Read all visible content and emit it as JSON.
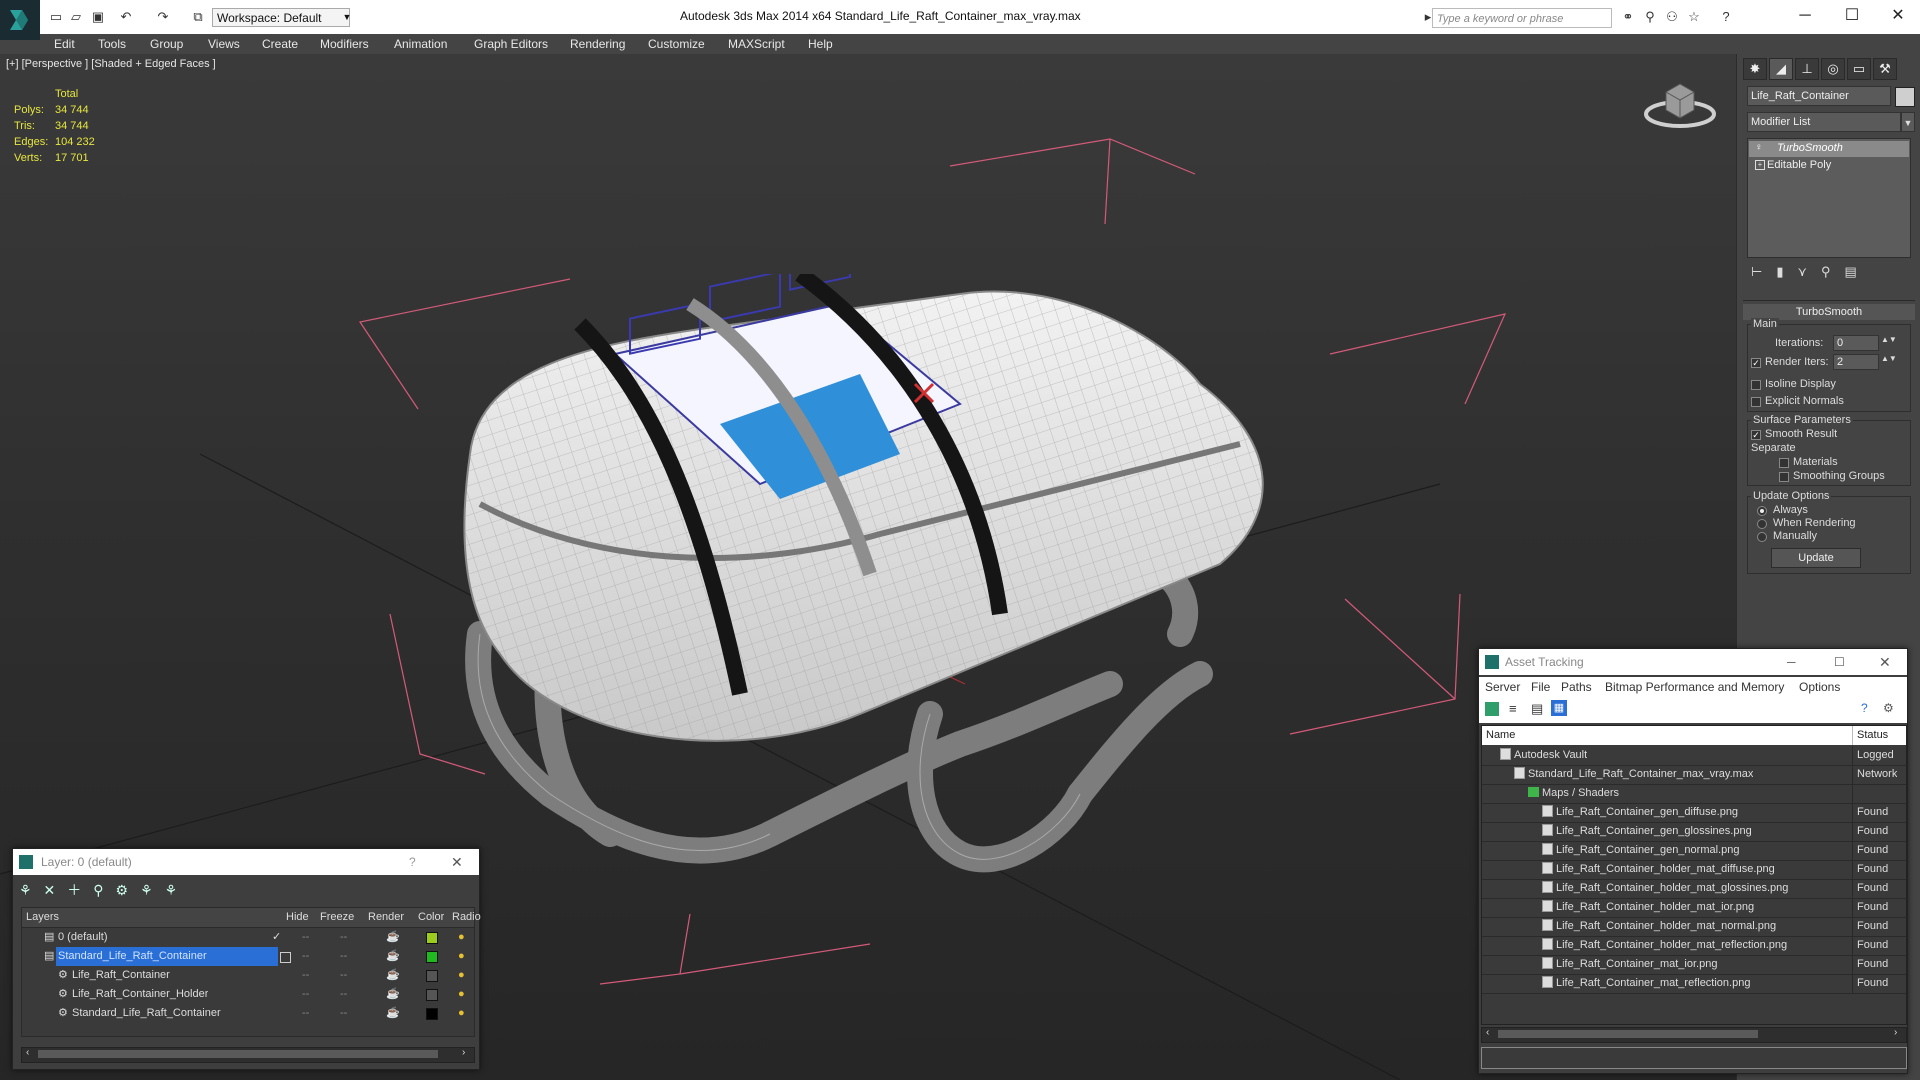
{
  "app": {
    "window_title": "Autodesk 3ds Max  2014 x64      Standard_Life_Raft_Container_max_vray.max",
    "workspace": "Workspace: Default",
    "search_placeholder": "Type a keyword or phrase"
  },
  "menu": [
    "Edit",
    "Tools",
    "Group",
    "Views",
    "Create",
    "Modifiers",
    "Animation",
    "Graph Editors",
    "Rendering",
    "Customize",
    "MAXScript",
    "Help"
  ],
  "viewport": {
    "label": "[+] [Perspective ] [Shaded + Edged Faces ]",
    "stats": {
      "header": "Total",
      "rows": [
        {
          "label": "Polys:",
          "value": "34 744"
        },
        {
          "label": "Tris:",
          "value": "34 744"
        },
        {
          "label": "Edges:",
          "value": "104 232"
        },
        {
          "label": "Verts:",
          "value": "17 701"
        }
      ]
    }
  },
  "command_panel": {
    "object_name": "Life_Raft_Container",
    "modifier_list": "Modifier List",
    "stack": [
      "TurboSmooth",
      "Editable Poly"
    ],
    "rollout_title": "TurboSmooth",
    "main_group": "Main",
    "iterations_label": "Iterations:",
    "iterations_value": "0",
    "render_iters_label": "Render Iters:",
    "render_iters_value": "2",
    "isoline": "Isoline Display",
    "explicit_normals": "Explicit Normals",
    "surface_group": "Surface Parameters",
    "smooth_result": "Smooth Result",
    "separate": "Separate",
    "materials": "Materials",
    "smoothing_groups": "Smoothing Groups",
    "update_group": "Update Options",
    "always": "Always",
    "when_rendering": "When Rendering",
    "manually": "Manually",
    "update_button": "Update"
  },
  "layer_panel": {
    "title": "Layer: 0 (default)",
    "help": "?",
    "columns": [
      "Layers",
      "Hide",
      "Freeze",
      "Render",
      "Color",
      "Radio"
    ],
    "rows": [
      {
        "name": "0 (default)",
        "color": "#9bcc1e",
        "selected": false,
        "indent": 1
      },
      {
        "name": "Standard_Life_Raft_Container",
        "color": "#22b822",
        "selected": true,
        "indent": 1
      },
      {
        "name": "Life_Raft_Container",
        "color": "#555555",
        "selected": false,
        "indent": 2
      },
      {
        "name": "Life_Raft_Container_Holder",
        "color": "#555555",
        "selected": false,
        "indent": 2
      },
      {
        "name": "Standard_Life_Raft_Container",
        "color": "#000000",
        "selected": false,
        "indent": 2
      }
    ]
  },
  "asset_tracking": {
    "title": "Asset Tracking",
    "menu": [
      "Server",
      "File",
      "Paths",
      "Bitmap Performance and Memory",
      "Options"
    ],
    "columns": [
      "Name",
      "Status"
    ],
    "rows": [
      {
        "name": "Autodesk Vault",
        "status": "Logged",
        "indent": 1
      },
      {
        "name": "Standard_Life_Raft_Container_max_vray.max",
        "status": "Network",
        "indent": 2
      },
      {
        "name": "Maps / Shaders",
        "status": "",
        "indent": 3
      },
      {
        "name": "Life_Raft_Container_gen_diffuse.png",
        "status": "Found",
        "indent": 4
      },
      {
        "name": "Life_Raft_Container_gen_glossines.png",
        "status": "Found",
        "indent": 4
      },
      {
        "name": "Life_Raft_Container_gen_normal.png",
        "status": "Found",
        "indent": 4
      },
      {
        "name": "Life_Raft_Container_holder_mat_diffuse.png",
        "status": "Found",
        "indent": 4
      },
      {
        "name": "Life_Raft_Container_holder_mat_glossines.png",
        "status": "Found",
        "indent": 4
      },
      {
        "name": "Life_Raft_Container_holder_mat_ior.png",
        "status": "Found",
        "indent": 4
      },
      {
        "name": "Life_Raft_Container_holder_mat_normal.png",
        "status": "Found",
        "indent": 4
      },
      {
        "name": "Life_Raft_Container_holder_mat_reflection.png",
        "status": "Found",
        "indent": 4
      },
      {
        "name": "Life_Raft_Container_mat_ior.png",
        "status": "Found",
        "indent": 4
      },
      {
        "name": "Life_Raft_Container_mat_reflection.png",
        "status": "Found",
        "indent": 4
      }
    ]
  }
}
